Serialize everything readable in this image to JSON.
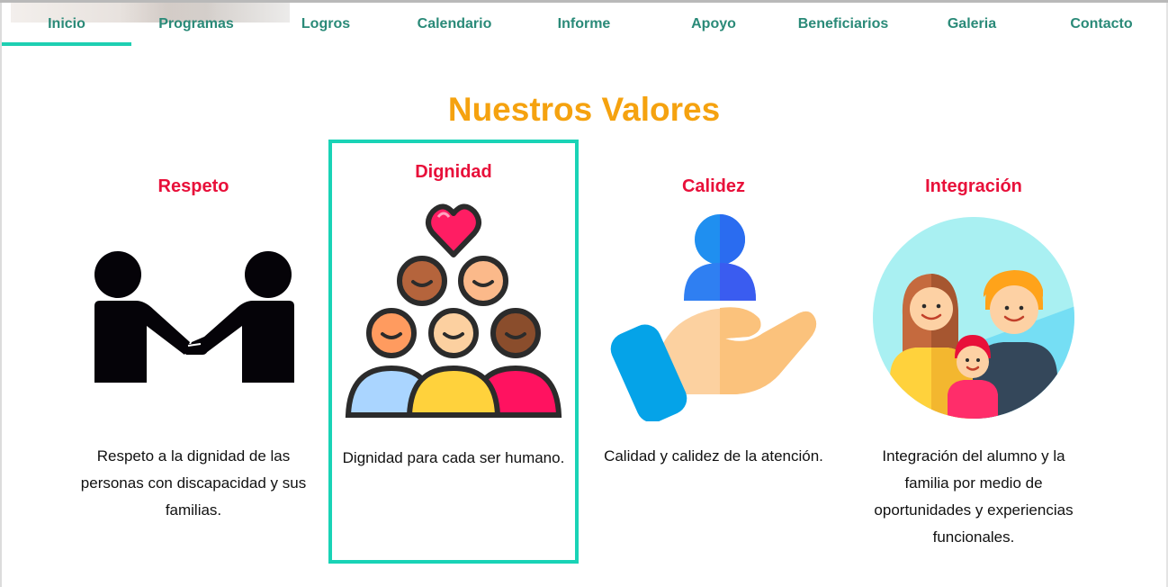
{
  "nav": {
    "items": [
      {
        "label": "Inicio",
        "active": true
      },
      {
        "label": "Programas"
      },
      {
        "label": "Logros"
      },
      {
        "label": "Calendario"
      },
      {
        "label": "Informe"
      },
      {
        "label": "Apoyo"
      },
      {
        "label": "Beneficiarios"
      },
      {
        "label": "Galeria"
      },
      {
        "label": "Contacto"
      }
    ]
  },
  "values": {
    "title": "Nuestros Valores",
    "cards": [
      {
        "title": "Respeto",
        "text": "Respeto a la dignidad de las personas con discapacidad y sus familias.",
        "icon": "handshake-icon"
      },
      {
        "title": "Dignidad",
        "text": "Dignidad para cada ser humano.",
        "icon": "people-heart-icon",
        "highlighted": true
      },
      {
        "title": "Calidez",
        "text": "Calidad y calidez de la atención.",
        "icon": "hand-holding-person-icon"
      },
      {
        "title": "Integración",
        "text": "Integración del alumno y la familia por medio de oportunidades y experiencias funcionales.",
        "icon": "family-icon"
      }
    ]
  },
  "colors": {
    "nav_text": "#2a8a78",
    "accent": "#1ecfb2",
    "title": "#f5a20f",
    "card_title": "#e8103a"
  }
}
